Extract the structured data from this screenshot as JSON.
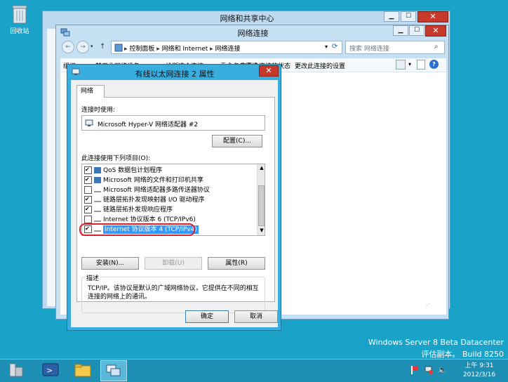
{
  "desktop": {
    "recycle_bin_label": "回收站",
    "watermark_line1": "Windows Server 8 Beta Datacenter",
    "watermark_line2": "评估副本。 Build 8250",
    "colors": {
      "background": "#1aa2c8",
      "taskbar": "#1e8fb4"
    }
  },
  "back_window": {
    "title": "网络和共享中心"
  },
  "network_window": {
    "title": "网络连接",
    "breadcrumb": [
      "控制面板",
      "网络和 Internet",
      "网络连接"
    ],
    "search_placeholder": "搜索 网络连接",
    "toolbar": [
      "组织 ▾",
      "禁用此网络设备",
      "诊断这个连接",
      "重命名此连接",
      "查看此连接的状态",
      "更改此连接的设置"
    ]
  },
  "dialog": {
    "title": "有线以太网连接 2 属性",
    "tab_label": "网络",
    "connect_using_label": "连接时使用:",
    "adapter_name": "Microsoft Hyper-V 网络适配器 #2",
    "configure_button": "配置(C)...",
    "items_label": "此连接使用下列项目(O):",
    "items": [
      {
        "checked": true,
        "label": "QoS 数据包计划程序"
      },
      {
        "checked": true,
        "label": "Microsoft 网络的文件和打印机共享"
      },
      {
        "checked": false,
        "label": "Microsoft 网络适配器多路传送器协议"
      },
      {
        "checked": true,
        "label": "链路层拓扑发现映射器 I/O 驱动程序"
      },
      {
        "checked": true,
        "label": "链路层拓扑发现响应程序"
      },
      {
        "checked": false,
        "label": "Internet 协议版本 6 (TCP/IPv6)"
      },
      {
        "checked": true,
        "label": "Internet 协议版本 4 (TCP/IPv4)",
        "selected": true
      }
    ],
    "install_button": "安装(N)...",
    "uninstall_button": "卸载(U)",
    "properties_button": "属性(R)",
    "description_label": "描述",
    "description_text": "TCP/IP。该协议是默认的广域网络协议，它提供在不同的相互连接的网络上的通讯。",
    "ok_button": "确定",
    "cancel_button": "取消",
    "colors": {
      "selection": "#3399ff",
      "highlight_ring": "#e0202a"
    }
  },
  "taskbar": {
    "time": "上午 9:31",
    "date": "2012/3/16"
  }
}
